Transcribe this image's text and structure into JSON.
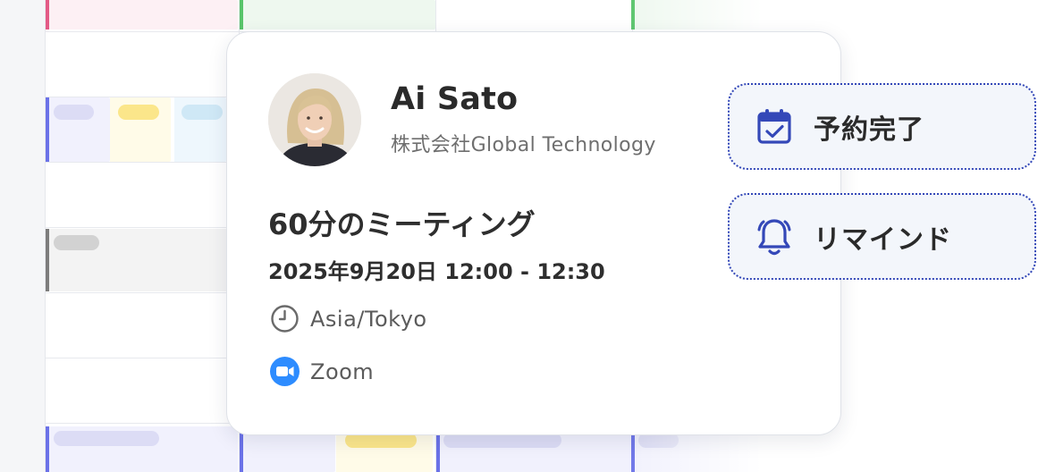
{
  "host": {
    "name": "Ai Sato",
    "company": "株式会社Global Technology"
  },
  "meeting": {
    "title": "60分のミーティング",
    "datetime": "2025年9月20日 12:00 - 12:30",
    "timezone": "Asia/Tokyo",
    "location": "Zoom"
  },
  "actions": {
    "booking_complete": "予約完了",
    "reminder": "リマインド"
  },
  "icons": {
    "clock": "clock-icon",
    "video": "zoom-video-icon",
    "calendar": "calendar-check-icon",
    "bell": "bell-icon"
  },
  "colors": {
    "accent_blue": "#3448b8",
    "zoom_blue": "#2d8cff",
    "chip_background": "#f3f6fb"
  }
}
